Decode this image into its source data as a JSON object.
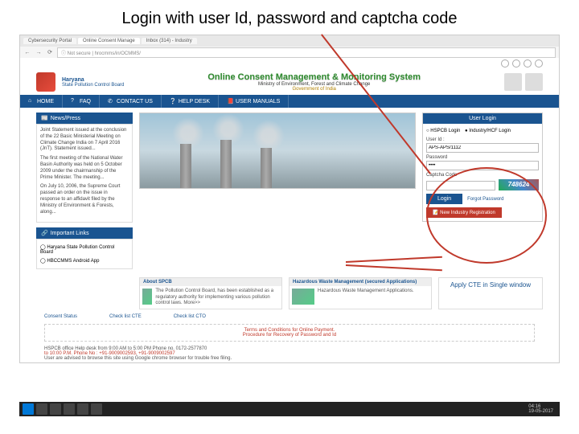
{
  "slide": {
    "title": "Login with user Id, password and captcha code"
  },
  "browser": {
    "tabs": [
      "Cybersecurity Portal",
      "Online Consent Manage",
      "Inbox (314) - Industry"
    ],
    "address_prefix": "Not secure",
    "address": "hrocmms/in/OCMMS/"
  },
  "header": {
    "org1": "Haryana",
    "org2": "State Pollution Control Board",
    "main_title": "Online Consent Management & Monitoring System",
    "sub1": "Ministry of Environment, Forest and Climate Change",
    "sub2": "Government of India"
  },
  "nav": {
    "items": [
      {
        "icon": "home-icon",
        "label": "HOME"
      },
      {
        "icon": "faq-icon",
        "label": "FAQ"
      },
      {
        "icon": "phone-icon",
        "label": "CONTACT US"
      },
      {
        "icon": "help-icon",
        "label": "HELP DESK"
      },
      {
        "icon": "book-icon",
        "label": "USER MANUALS"
      }
    ]
  },
  "news": {
    "head": "News/Press",
    "body1": "Joint Statement issued at the conclusion of the 22 Basic Ministerial Meeting on Climate Change India on 7 April 2016 (JnT). Statement issued...",
    "body2": "The first meeting of the National Water Basin Authority was held on 5 October 2009 under the chairmanship of the Prime Minister. The meeting...",
    "body3": "On July 10, 2006, the Supreme Court passed an order on the issue in response to an affidavit filed by the Ministry of Environment & Forests, along..."
  },
  "imp_links": {
    "head": "Important Links",
    "items": [
      "Haryana State Pollution Control Board",
      "HBCCMMS Android App"
    ]
  },
  "about": {
    "head1": "About SPCB",
    "body1": "The Pollution Control Board, has been established as a regulatory authority for implementing various pollution control laws. More>>",
    "head2": "Hazardous Waste Management (secured Applications)",
    "body2": "Hazardous Waste Management Applications."
  },
  "login": {
    "head": "User Login",
    "tab1": "HSPCB Login",
    "tab2": "Industry/HCF Login",
    "userid_label": "User Id :",
    "userid_value": "APS-APS/1112",
    "password_label": "Password",
    "password_value": "••••",
    "captcha_label": "Captcha Code",
    "captcha_value": "",
    "captcha_image": "748624",
    "login_btn": "Login",
    "forgot": "Forgot Password",
    "register": "New Industry Registration"
  },
  "apply": {
    "text": "Apply CTE in Single window"
  },
  "status": {
    "s1": "Consent Status",
    "s2": "Check list CTE",
    "s3": "Check list CTO"
  },
  "terms": {
    "line1": "Terms and Conditions for Online Payment.",
    "line2": "Procedure for Recovery of Password and Id"
  },
  "footer": {
    "helpdesk": "HSPCB office Help desk from 9:00 AM to 5:00 PM Phone no. 0172-2577870",
    "timing": "to 10:00 P.M. Phone No : +91-9009002593, +91-9009002597",
    "browser_note": "User are advised to browse this site using Google chrome browser for trouble free filing."
  },
  "taskbar": {
    "time": "04:16",
    "date": "19-05-2017"
  }
}
